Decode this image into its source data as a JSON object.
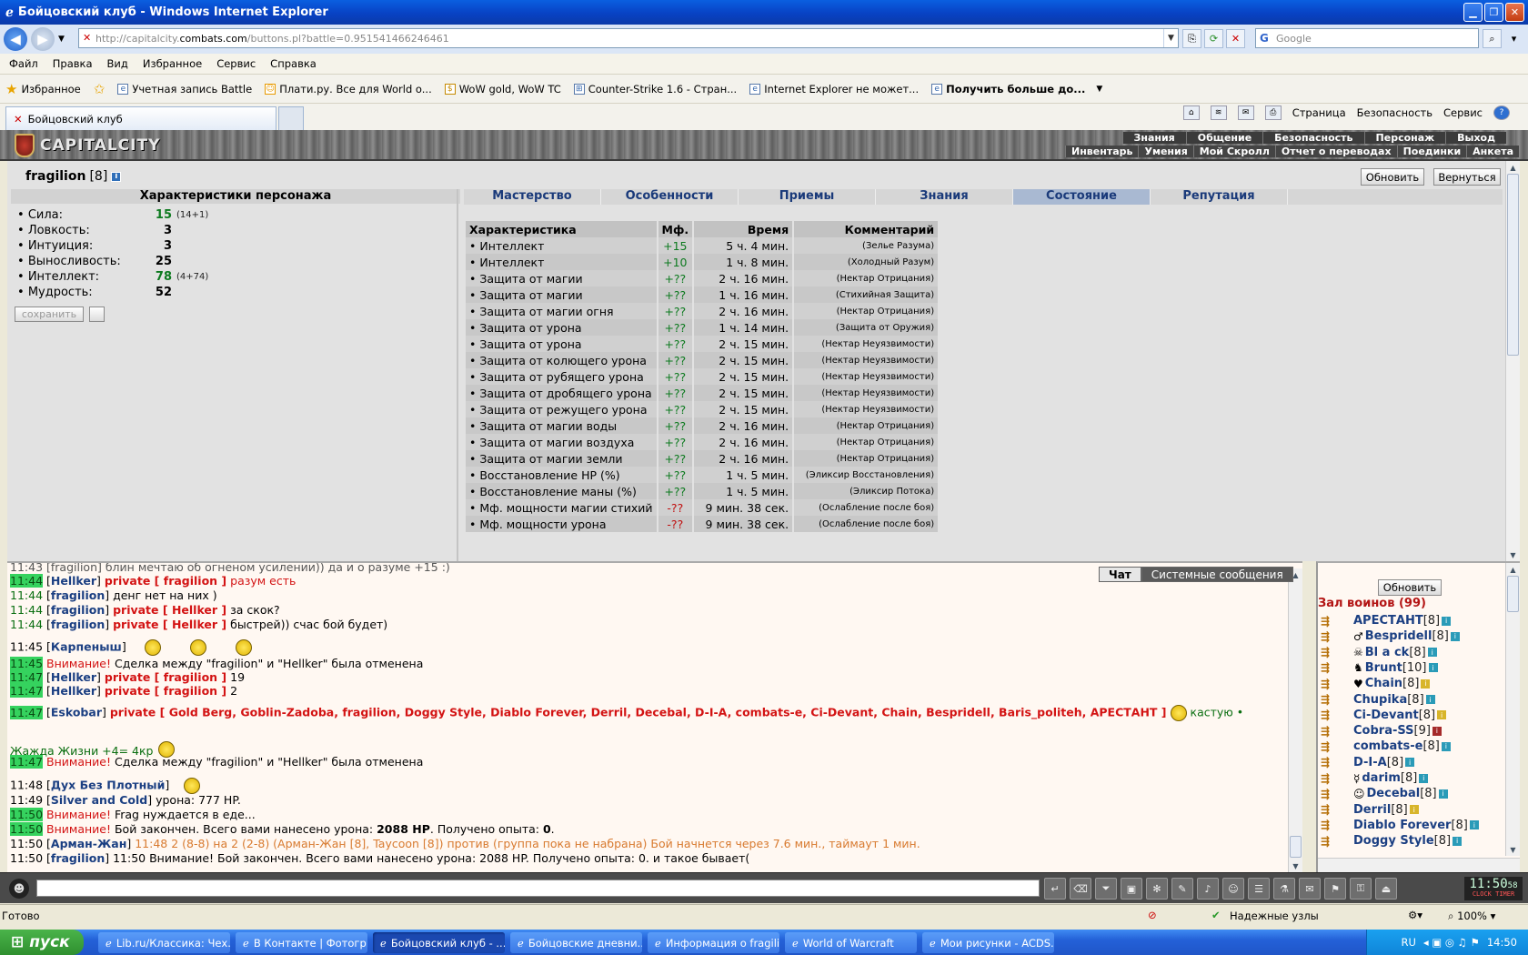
{
  "window": {
    "title": "Бойцовский клуб - Windows Internet Explorer"
  },
  "address": {
    "prefix": "http://capitalcity.",
    "domain": "combats.com",
    "path": "/buttons.pl?battle=0.951541466246461",
    "search_placeholder": "Google"
  },
  "menu": [
    "Файл",
    "Правка",
    "Вид",
    "Избранное",
    "Сервис",
    "Справка"
  ],
  "favorites": {
    "label": "Избранное",
    "items": [
      "Учетная запись Battle",
      "Плати.ру. Все для World o...",
      "WoW gold, WoW TC",
      "Counter-Strike 1.6 - Стран...",
      "Internet Explorer не может...",
      "Получить больше до..."
    ]
  },
  "tab": {
    "label": "Бойцовский клуб"
  },
  "commandbar": [
    "Страница",
    "Безопасность",
    "Сервис"
  ],
  "site": {
    "logo": "CAPITALCITY",
    "nav_top": [
      "Знания",
      "Общение",
      "Безопасность",
      "Персонаж",
      "Выход"
    ],
    "nav_bottom": [
      "Инвентарь",
      "Умения",
      "Мой Скролл",
      "Отчет о переводах",
      "Поединки",
      "Анкета"
    ]
  },
  "player": {
    "name": "fragilion",
    "level": "[8]"
  },
  "buttons": {
    "refresh": "Обновить",
    "back": "Вернуться",
    "save": "сохранить"
  },
  "characteristics": {
    "title": "Характеристики персонажа",
    "stats": [
      {
        "name": "Сила:",
        "value": "15",
        "extra": "(14+1)",
        "green": true
      },
      {
        "name": "Ловкость:",
        "value": "3",
        "extra": "",
        "green": false
      },
      {
        "name": "Интуиция:",
        "value": "3",
        "extra": "",
        "green": false
      },
      {
        "name": "Выносливость:",
        "value": "25",
        "extra": "",
        "green": false
      },
      {
        "name": "Интеллект:",
        "value": "78",
        "extra": "(4+74)",
        "green": true
      },
      {
        "name": "Мудрость:",
        "value": "52",
        "extra": "",
        "green": false
      }
    ]
  },
  "tabs": [
    "Мастерство",
    "Особенности",
    "Приемы",
    "Знания",
    "Состояние",
    "Репутация"
  ],
  "effects": {
    "headers": [
      "Характеристика",
      "Мф.",
      "Время",
      "Комментарий"
    ],
    "rows": [
      [
        "Интеллект",
        "+15",
        "5 ч. 4 мин.",
        "(Зелье Разума)"
      ],
      [
        "Интеллект",
        "+10",
        "1 ч. 8 мин.",
        "(Холодный Разум)"
      ],
      [
        "Защита от магии",
        "+??",
        "2 ч. 16 мин.",
        "(Нектар Отрицания)"
      ],
      [
        "Защита от магии",
        "+??",
        "1 ч. 16 мин.",
        "(Стихийная Защита)"
      ],
      [
        "Защита от магии огня",
        "+??",
        "2 ч. 16 мин.",
        "(Нектар Отрицания)"
      ],
      [
        "Защита от урона",
        "+??",
        "1 ч. 14 мин.",
        "(Защита от Оружия)"
      ],
      [
        "Защита от урона",
        "+??",
        "2 ч. 15 мин.",
        "(Нектар Неуязвимости)"
      ],
      [
        "Защита от колющего урона",
        "+??",
        "2 ч. 15 мин.",
        "(Нектар Неуязвимости)"
      ],
      [
        "Защита от рубящего урона",
        "+??",
        "2 ч. 15 мин.",
        "(Нектар Неуязвимости)"
      ],
      [
        "Защита от дробящего урона",
        "+??",
        "2 ч. 15 мин.",
        "(Нектар Неуязвимости)"
      ],
      [
        "Защита от режущего урона",
        "+??",
        "2 ч. 15 мин.",
        "(Нектар Неуязвимости)"
      ],
      [
        "Защита от магии воды",
        "+??",
        "2 ч. 16 мин.",
        "(Нектар Отрицания)"
      ],
      [
        "Защита от магии воздуха",
        "+??",
        "2 ч. 16 мин.",
        "(Нектар Отрицания)"
      ],
      [
        "Защита от магии земли",
        "+??",
        "2 ч. 16 мин.",
        "(Нектар Отрицания)"
      ],
      [
        "Восстановление HP (%)",
        "+??",
        "1 ч. 5 мин.",
        "(Эликсир Восстановления)"
      ],
      [
        "Восстановление маны (%)",
        "+??",
        "1 ч. 5 мин.",
        "(Эликсир Потока)"
      ],
      [
        "Мф. мощности магии стихий",
        "-??",
        "9 мин. 38 сек.",
        "(Ослабление после боя)"
      ],
      [
        "Мф. мощности урона",
        "-??",
        "9 мин. 38 сек.",
        "(Ослабление после боя)"
      ]
    ]
  },
  "chat": {
    "tabs": [
      "Чат",
      "Системные сообщения"
    ],
    "first_line": "11:43 [fragilion] блин мечтаю об огненом усилении)) да и о разуме +15 :)",
    "lines": [
      {
        "time": "11:44",
        "hl": true,
        "name": "Hellker",
        "priv": "fragilion",
        "text": "разум есть",
        "textcls": "warn"
      },
      {
        "time": "11:44",
        "hl": false,
        "name": "fragilion",
        "priv": "",
        "text": "денг нет на них )",
        "textcls": ""
      },
      {
        "time": "11:44",
        "hl": false,
        "name": "fragilion",
        "priv": "Hellker",
        "text": "за скок?",
        "textcls": ""
      },
      {
        "time": "11:44",
        "hl": false,
        "name": "fragilion",
        "priv": "Hellker",
        "text": "быстрей)) счас бой будет)",
        "textcls": ""
      }
    ],
    "karp": {
      "time": "11:45",
      "name": "Карпеныш"
    },
    "cancel1": {
      "time": "11:45",
      "warn": "Внимание!",
      "text": "Сделка между \"fragilion\" и \"Hellker\" была отменена"
    },
    "h1": {
      "time": "11:47",
      "name": "Hellker",
      "priv": "fragilion",
      "text": "19"
    },
    "h2": {
      "time": "11:47",
      "name": "Hellker",
      "priv": "fragilion",
      "text": "2"
    },
    "esk": {
      "time": "11:47",
      "name": "Eskobar",
      "priv": "Gold Berg, Goblin-Zadoba, fragilion, Doggy Style, Diablo Forever, Derril, Decebal, D-I-A, combats-e, Ci-Devant, Chain, Bespridell, Baris_politeh, АРЕСТАНТ",
      "text": "кастую •"
    },
    "thirst": "Жажда Жизни +4= 4кр",
    "cancel2": {
      "time": "11:47",
      "warn": "Внимание!",
      "text": "Сделка между \"fragilion\" и \"Hellker\" была отменена"
    },
    "duh": {
      "time": "11:48",
      "name": "Дух Без Плотный"
    },
    "silver": {
      "time": "11:49",
      "name": "Silver and Cold",
      "text": "урона: 777 HP."
    },
    "frag": {
      "time": "11:50",
      "warn": "Внимание!",
      "text": "Frag нуждается в еде..."
    },
    "end": {
      "time": "11:50",
      "warn": "Внимание!",
      "text1": "Бой закончен. Всего вами нанесено урона:",
      "hp": "2088 HP",
      "text2": ". Получено опыта:",
      "exp": "0",
      "text3": "."
    },
    "arman": {
      "time": "11:50",
      "name": "Арман-Жан",
      "text": "11:48 2 (8-8) на 2 (2-8) (Арман-Жан [8], Taycoon [8]) против (группа пока не набрана) Бой начнется через 7.6 мин., таймаут 1 мин."
    },
    "last": {
      "time": "11:50",
      "name": "fragilion",
      "text": "11:50 Внимание! Бой закончен. Всего вами нанесено урона: 2088 HP. Получено опыта: 0. и такое бывает("
    }
  },
  "hall": {
    "refresh": "Обновить",
    "title": "Зал воинов (99)",
    "users": [
      {
        "name": "АРЕСТАНТ",
        "level": "[8]",
        "info": "i",
        "sym": ""
      },
      {
        "name": "Bespridell",
        "level": "[8]",
        "info": "i",
        "sym": "♂"
      },
      {
        "name": "Bl a ck",
        "level": "[8]",
        "info": "i",
        "sym": "☠"
      },
      {
        "name": "Brunt",
        "level": "[10]",
        "info": "i",
        "sym": "♞"
      },
      {
        "name": "Chain",
        "level": "[8]",
        "info": "y",
        "sym": "♥"
      },
      {
        "name": "Chupika",
        "level": "[8]",
        "info": "i",
        "sym": ""
      },
      {
        "name": "Ci-Devant",
        "level": "[8]",
        "info": "y",
        "sym": ""
      },
      {
        "name": "Cobra-SS",
        "level": "[9]",
        "info": "r",
        "sym": ""
      },
      {
        "name": "combats-e",
        "level": "[8]",
        "info": "i",
        "sym": ""
      },
      {
        "name": "D-I-A",
        "level": "[8]",
        "info": "i",
        "sym": ""
      },
      {
        "name": "darim",
        "level": "[8]",
        "info": "i",
        "sym": "☿"
      },
      {
        "name": "Decebal",
        "level": "[8]",
        "info": "i",
        "sym": "☺"
      },
      {
        "name": "Derril",
        "level": "[8]",
        "info": "y",
        "sym": ""
      },
      {
        "name": "Diablo Forever",
        "level": "[8]",
        "info": "i",
        "sym": ""
      },
      {
        "name": "Doggy Style",
        "level": "[8]",
        "info": "i",
        "sym": ""
      }
    ]
  },
  "clock": {
    "time": "11:50",
    "sec": "58",
    "label": "CLOCK TIMER"
  },
  "status": {
    "ready": "Готово",
    "zone": "Надежные узлы",
    "zoom": "100%"
  },
  "taskbar": {
    "start": "пуск",
    "items": [
      "Lib.ru/Классика: Чех...",
      "В Контакте | Фотогр...",
      "Бойцовский клуб - ...",
      "Бойцовские дневни...",
      "Информация о fragili...",
      "World of Warcraft",
      "Мои рисунки - ACDS..."
    ],
    "lang": "RU",
    "time": "14:50"
  }
}
